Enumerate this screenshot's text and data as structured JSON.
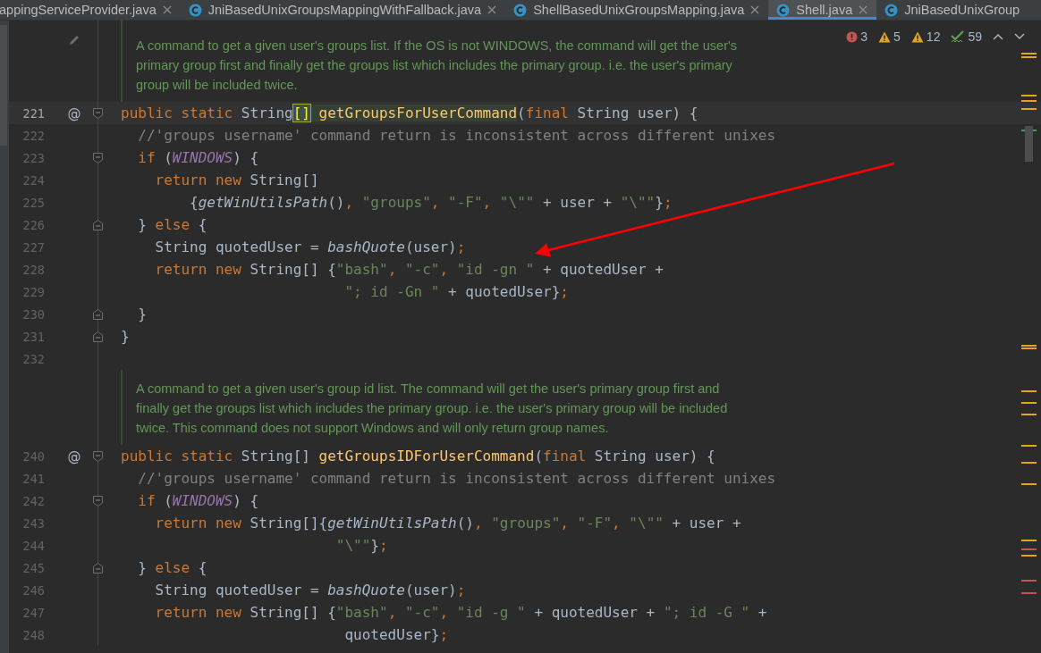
{
  "tabs": [
    {
      "label": "appingServiceProvider.java",
      "selected": false,
      "has_icon": false,
      "closable": true
    },
    {
      "label": "JniBasedUnixGroupsMappingWithFallback.java",
      "selected": false,
      "has_icon": true,
      "closable": true
    },
    {
      "label": "ShellBasedUnixGroupsMapping.java",
      "selected": false,
      "has_icon": true,
      "closable": true
    },
    {
      "label": "Shell.java",
      "selected": true,
      "has_icon": true,
      "closable": true
    },
    {
      "label": "JniBasedUnixGroup",
      "selected": false,
      "has_icon": true,
      "closable": false
    }
  ],
  "inspections": [
    {
      "kind": "error",
      "count": "3"
    },
    {
      "kind": "warning",
      "count": "5"
    },
    {
      "kind": "weak",
      "count": "12"
    },
    {
      "kind": "typo",
      "count": "59"
    }
  ],
  "editor": [
    {
      "kind": "doc",
      "editable": true,
      "lines": [
        "A command to get a given user's groups list. If the OS is not WINDOWS, the command will get the user's",
        "primary group first and finally get the groups list which includes the primary group. i.e. the user's primary",
        "group will be included twice."
      ]
    },
    {
      "kind": "code",
      "number": "221",
      "current": true,
      "mark": "@",
      "fold": {
        "kind": "start"
      },
      "tokens": [
        {
          "kind": "kw",
          "t": "public static "
        },
        {
          "kind": "txt",
          "t": "String"
        },
        {
          "kind": "match",
          "t": "[]"
        },
        {
          "kind": "hl",
          "t": " getGroupsForUserCommand"
        },
        {
          "kind": "txt",
          "t": "("
        },
        {
          "kind": "kw",
          "t": "final "
        },
        {
          "kind": "txt",
          "t": "String user) {"
        }
      ]
    },
    {
      "kind": "code",
      "number": "222",
      "current": false,
      "tokens": [
        {
          "kind": "cmt",
          "t": "  //'groups username' command return is inconsistent across different unixes"
        }
      ]
    },
    {
      "kind": "code",
      "number": "223",
      "current": false,
      "fold": {
        "kind": "start"
      },
      "tokens": [
        {
          "kind": "kw",
          "t": "  if"
        },
        {
          "kind": "txt",
          "t": " ("
        },
        {
          "kind": "const",
          "t": "WINDOWS"
        },
        {
          "kind": "txt",
          "t": ") {"
        }
      ]
    },
    {
      "kind": "code",
      "number": "224",
      "current": false,
      "tokens": [
        {
          "kind": "kw",
          "t": "    return new "
        },
        {
          "kind": "txt",
          "t": "String[]"
        }
      ]
    },
    {
      "kind": "code",
      "number": "225",
      "current": false,
      "tokens": [
        {
          "kind": "txt",
          "t": "        {"
        },
        {
          "kind": "it",
          "t": "getWinUtilsPath"
        },
        {
          "kind": "txt",
          "t": "()"
        },
        {
          "kind": "punct",
          "t": ", "
        },
        {
          "kind": "str",
          "t": "\"groups\""
        },
        {
          "kind": "punct",
          "t": ", "
        },
        {
          "kind": "str",
          "t": "\"-F\""
        },
        {
          "kind": "punct",
          "t": ", "
        },
        {
          "kind": "str",
          "t": "\"\\\"\""
        },
        {
          "kind": "txt",
          "t": " + user + "
        },
        {
          "kind": "str",
          "t": "\"\\\"\""
        },
        {
          "kind": "txt",
          "t": "}"
        },
        {
          "kind": "punct",
          "t": ";"
        }
      ]
    },
    {
      "kind": "code",
      "number": "226",
      "current": false,
      "fold": {
        "kind": "end"
      },
      "tokens": [
        {
          "kind": "txt",
          "t": "  } "
        },
        {
          "kind": "kw",
          "t": "else"
        },
        {
          "kind": "txt",
          "t": " {"
        }
      ]
    },
    {
      "kind": "code",
      "number": "227",
      "current": false,
      "tokens": [
        {
          "kind": "txt",
          "t": "    String quotedUser = "
        },
        {
          "kind": "it",
          "t": "bashQuote"
        },
        {
          "kind": "txt",
          "t": "(user)"
        },
        {
          "kind": "punct",
          "t": ";"
        }
      ]
    },
    {
      "kind": "code",
      "number": "228",
      "current": false,
      "tokens": [
        {
          "kind": "kw",
          "t": "    return new "
        },
        {
          "kind": "txt",
          "t": "String[] {"
        },
        {
          "kind": "str",
          "t": "\"bash\""
        },
        {
          "kind": "punct",
          "t": ", "
        },
        {
          "kind": "str",
          "t": "\"-c\""
        },
        {
          "kind": "punct",
          "t": ", "
        },
        {
          "kind": "str",
          "t": "\"id -gn \""
        },
        {
          "kind": "txt",
          "t": " + quotedUser +"
        }
      ]
    },
    {
      "kind": "code",
      "number": "229",
      "current": false,
      "tokens": [
        {
          "kind": "str",
          "t": "                          \"; id -Gn \""
        },
        {
          "kind": "txt",
          "t": " + quotedUser}"
        },
        {
          "kind": "punct",
          "t": ";"
        }
      ]
    },
    {
      "kind": "code",
      "number": "230",
      "current": false,
      "fold": {
        "kind": "end"
      },
      "tokens": [
        {
          "kind": "txt",
          "t": "  }"
        }
      ]
    },
    {
      "kind": "code",
      "number": "231",
      "current": false,
      "fold": {
        "kind": "end"
      },
      "tokens": [
        {
          "kind": "txt",
          "t": "}"
        }
      ]
    },
    {
      "kind": "code",
      "number": "232",
      "current": false
    },
    {
      "kind": "doc",
      "editable": false,
      "lines": [
        "A command to get a given user's group id list. The command will get the user's primary group first and",
        "finally get the groups list which includes the primary group. i.e. the user's primary group will be included",
        "twice. This command does not support Windows and will only return group names."
      ]
    },
    {
      "kind": "code",
      "number": "240",
      "current": false,
      "mark": "@",
      "fold": {
        "kind": "start"
      },
      "tokens": [
        {
          "kind": "kw",
          "t": "public static "
        },
        {
          "kind": "txt",
          "t": "String[] "
        },
        {
          "kind": "decl",
          "t": "getGroupsIDForUserCommand"
        },
        {
          "kind": "txt",
          "t": "("
        },
        {
          "kind": "kw",
          "t": "final "
        },
        {
          "kind": "txt",
          "t": "String user) {"
        }
      ]
    },
    {
      "kind": "code",
      "number": "241",
      "current": false,
      "tokens": [
        {
          "kind": "cmt",
          "t": "  //'groups username' command return is inconsistent across different unixes"
        }
      ]
    },
    {
      "kind": "code",
      "number": "242",
      "current": false,
      "fold": {
        "kind": "start"
      },
      "tokens": [
        {
          "kind": "kw",
          "t": "  if"
        },
        {
          "kind": "txt",
          "t": " ("
        },
        {
          "kind": "const",
          "t": "WINDOWS"
        },
        {
          "kind": "txt",
          "t": ") {"
        }
      ]
    },
    {
      "kind": "code",
      "number": "243",
      "current": false,
      "tokens": [
        {
          "kind": "kw",
          "t": "    return new "
        },
        {
          "kind": "txt",
          "t": "String[]{"
        },
        {
          "kind": "it",
          "t": "getWinUtilsPath"
        },
        {
          "kind": "txt",
          "t": "()"
        },
        {
          "kind": "punct",
          "t": ", "
        },
        {
          "kind": "str",
          "t": "\"groups\""
        },
        {
          "kind": "punct",
          "t": ", "
        },
        {
          "kind": "str",
          "t": "\"-F\""
        },
        {
          "kind": "punct",
          "t": ", "
        },
        {
          "kind": "str",
          "t": "\"\\\"\""
        },
        {
          "kind": "txt",
          "t": " + user +"
        }
      ]
    },
    {
      "kind": "code",
      "number": "244",
      "current": false,
      "tokens": [
        {
          "kind": "str",
          "t": "                         \"\\\"\""
        },
        {
          "kind": "txt",
          "t": "}"
        },
        {
          "kind": "punct",
          "t": ";"
        }
      ]
    },
    {
      "kind": "code",
      "number": "245",
      "current": false,
      "fold": {
        "kind": "end"
      },
      "tokens": [
        {
          "kind": "txt",
          "t": "  } "
        },
        {
          "kind": "kw",
          "t": "else"
        },
        {
          "kind": "txt",
          "t": " {"
        }
      ]
    },
    {
      "kind": "code",
      "number": "246",
      "current": false,
      "tokens": [
        {
          "kind": "txt",
          "t": "    String quotedUser = "
        },
        {
          "kind": "it",
          "t": "bashQuote"
        },
        {
          "kind": "txt",
          "t": "(user)"
        },
        {
          "kind": "punct",
          "t": ";"
        }
      ]
    },
    {
      "kind": "code",
      "number": "247",
      "current": false,
      "tokens": [
        {
          "kind": "kw",
          "t": "    return new "
        },
        {
          "kind": "txt",
          "t": "String[] {"
        },
        {
          "kind": "str",
          "t": "\"bash\""
        },
        {
          "kind": "punct",
          "t": ", "
        },
        {
          "kind": "str",
          "t": "\"-c\""
        },
        {
          "kind": "punct",
          "t": ", "
        },
        {
          "kind": "str",
          "t": "\"id -g \""
        },
        {
          "kind": "txt",
          "t": " + quotedUser + "
        },
        {
          "kind": "str",
          "t": "\"; id -G \""
        },
        {
          "kind": "txt",
          "t": " +"
        }
      ]
    },
    {
      "kind": "code",
      "number": "248",
      "current": false,
      "tokens": [
        {
          "kind": "txt",
          "t": "                          quotedUser}"
        },
        {
          "kind": "punct",
          "t": ";"
        }
      ]
    }
  ]
}
